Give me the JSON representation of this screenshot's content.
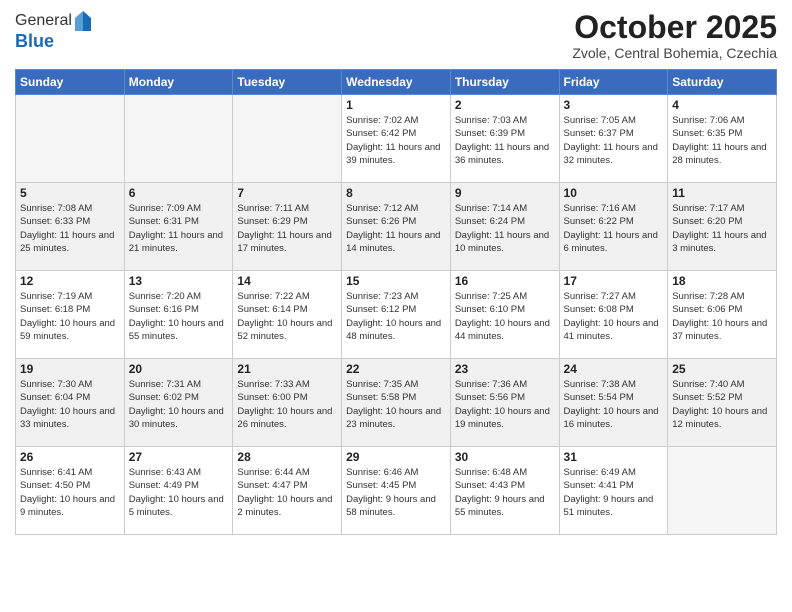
{
  "logo": {
    "general": "General",
    "blue": "Blue"
  },
  "header": {
    "month": "October 2025",
    "location": "Zvole, Central Bohemia, Czechia"
  },
  "weekdays": [
    "Sunday",
    "Monday",
    "Tuesday",
    "Wednesday",
    "Thursday",
    "Friday",
    "Saturday"
  ],
  "weeks": [
    [
      {
        "day": "",
        "sunrise": "",
        "sunset": "",
        "daylight": "",
        "empty": true
      },
      {
        "day": "",
        "sunrise": "",
        "sunset": "",
        "daylight": "",
        "empty": true
      },
      {
        "day": "",
        "sunrise": "",
        "sunset": "",
        "daylight": "",
        "empty": true
      },
      {
        "day": "1",
        "sunrise": "Sunrise: 7:02 AM",
        "sunset": "Sunset: 6:42 PM",
        "daylight": "Daylight: 11 hours and 39 minutes."
      },
      {
        "day": "2",
        "sunrise": "Sunrise: 7:03 AM",
        "sunset": "Sunset: 6:39 PM",
        "daylight": "Daylight: 11 hours and 36 minutes."
      },
      {
        "day": "3",
        "sunrise": "Sunrise: 7:05 AM",
        "sunset": "Sunset: 6:37 PM",
        "daylight": "Daylight: 11 hours and 32 minutes."
      },
      {
        "day": "4",
        "sunrise": "Sunrise: 7:06 AM",
        "sunset": "Sunset: 6:35 PM",
        "daylight": "Daylight: 11 hours and 28 minutes."
      }
    ],
    [
      {
        "day": "5",
        "sunrise": "Sunrise: 7:08 AM",
        "sunset": "Sunset: 6:33 PM",
        "daylight": "Daylight: 11 hours and 25 minutes."
      },
      {
        "day": "6",
        "sunrise": "Sunrise: 7:09 AM",
        "sunset": "Sunset: 6:31 PM",
        "daylight": "Daylight: 11 hours and 21 minutes."
      },
      {
        "day": "7",
        "sunrise": "Sunrise: 7:11 AM",
        "sunset": "Sunset: 6:29 PM",
        "daylight": "Daylight: 11 hours and 17 minutes."
      },
      {
        "day": "8",
        "sunrise": "Sunrise: 7:12 AM",
        "sunset": "Sunset: 6:26 PM",
        "daylight": "Daylight: 11 hours and 14 minutes."
      },
      {
        "day": "9",
        "sunrise": "Sunrise: 7:14 AM",
        "sunset": "Sunset: 6:24 PM",
        "daylight": "Daylight: 11 hours and 10 minutes."
      },
      {
        "day": "10",
        "sunrise": "Sunrise: 7:16 AM",
        "sunset": "Sunset: 6:22 PM",
        "daylight": "Daylight: 11 hours and 6 minutes."
      },
      {
        "day": "11",
        "sunrise": "Sunrise: 7:17 AM",
        "sunset": "Sunset: 6:20 PM",
        "daylight": "Daylight: 11 hours and 3 minutes."
      }
    ],
    [
      {
        "day": "12",
        "sunrise": "Sunrise: 7:19 AM",
        "sunset": "Sunset: 6:18 PM",
        "daylight": "Daylight: 10 hours and 59 minutes."
      },
      {
        "day": "13",
        "sunrise": "Sunrise: 7:20 AM",
        "sunset": "Sunset: 6:16 PM",
        "daylight": "Daylight: 10 hours and 55 minutes."
      },
      {
        "day": "14",
        "sunrise": "Sunrise: 7:22 AM",
        "sunset": "Sunset: 6:14 PM",
        "daylight": "Daylight: 10 hours and 52 minutes."
      },
      {
        "day": "15",
        "sunrise": "Sunrise: 7:23 AM",
        "sunset": "Sunset: 6:12 PM",
        "daylight": "Daylight: 10 hours and 48 minutes."
      },
      {
        "day": "16",
        "sunrise": "Sunrise: 7:25 AM",
        "sunset": "Sunset: 6:10 PM",
        "daylight": "Daylight: 10 hours and 44 minutes."
      },
      {
        "day": "17",
        "sunrise": "Sunrise: 7:27 AM",
        "sunset": "Sunset: 6:08 PM",
        "daylight": "Daylight: 10 hours and 41 minutes."
      },
      {
        "day": "18",
        "sunrise": "Sunrise: 7:28 AM",
        "sunset": "Sunset: 6:06 PM",
        "daylight": "Daylight: 10 hours and 37 minutes."
      }
    ],
    [
      {
        "day": "19",
        "sunrise": "Sunrise: 7:30 AM",
        "sunset": "Sunset: 6:04 PM",
        "daylight": "Daylight: 10 hours and 33 minutes."
      },
      {
        "day": "20",
        "sunrise": "Sunrise: 7:31 AM",
        "sunset": "Sunset: 6:02 PM",
        "daylight": "Daylight: 10 hours and 30 minutes."
      },
      {
        "day": "21",
        "sunrise": "Sunrise: 7:33 AM",
        "sunset": "Sunset: 6:00 PM",
        "daylight": "Daylight: 10 hours and 26 minutes."
      },
      {
        "day": "22",
        "sunrise": "Sunrise: 7:35 AM",
        "sunset": "Sunset: 5:58 PM",
        "daylight": "Daylight: 10 hours and 23 minutes."
      },
      {
        "day": "23",
        "sunrise": "Sunrise: 7:36 AM",
        "sunset": "Sunset: 5:56 PM",
        "daylight": "Daylight: 10 hours and 19 minutes."
      },
      {
        "day": "24",
        "sunrise": "Sunrise: 7:38 AM",
        "sunset": "Sunset: 5:54 PM",
        "daylight": "Daylight: 10 hours and 16 minutes."
      },
      {
        "day": "25",
        "sunrise": "Sunrise: 7:40 AM",
        "sunset": "Sunset: 5:52 PM",
        "daylight": "Daylight: 10 hours and 12 minutes."
      }
    ],
    [
      {
        "day": "26",
        "sunrise": "Sunrise: 6:41 AM",
        "sunset": "Sunset: 4:50 PM",
        "daylight": "Daylight: 10 hours and 9 minutes."
      },
      {
        "day": "27",
        "sunrise": "Sunrise: 6:43 AM",
        "sunset": "Sunset: 4:49 PM",
        "daylight": "Daylight: 10 hours and 5 minutes."
      },
      {
        "day": "28",
        "sunrise": "Sunrise: 6:44 AM",
        "sunset": "Sunset: 4:47 PM",
        "daylight": "Daylight: 10 hours and 2 minutes."
      },
      {
        "day": "29",
        "sunrise": "Sunrise: 6:46 AM",
        "sunset": "Sunset: 4:45 PM",
        "daylight": "Daylight: 9 hours and 58 minutes."
      },
      {
        "day": "30",
        "sunrise": "Sunrise: 6:48 AM",
        "sunset": "Sunset: 4:43 PM",
        "daylight": "Daylight: 9 hours and 55 minutes."
      },
      {
        "day": "31",
        "sunrise": "Sunrise: 6:49 AM",
        "sunset": "Sunset: 4:41 PM",
        "daylight": "Daylight: 9 hours and 51 minutes."
      },
      {
        "day": "",
        "sunrise": "",
        "sunset": "",
        "daylight": "",
        "empty": true
      }
    ]
  ]
}
